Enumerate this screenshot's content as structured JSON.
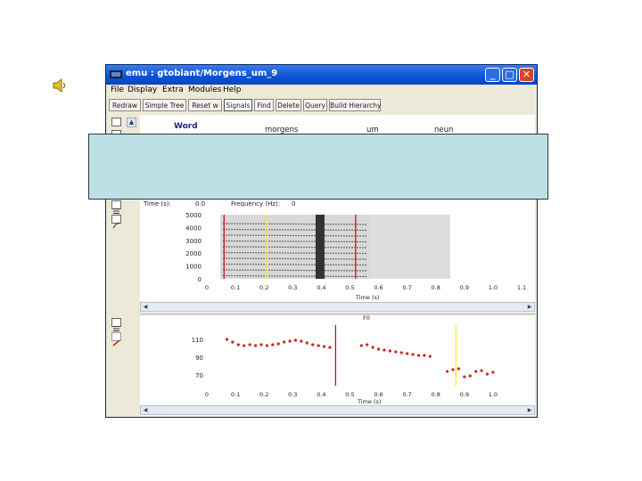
{
  "window": {
    "title": "emu : gtobiant/Morgens_um_9",
    "controls": [
      "_",
      "□",
      "✕"
    ]
  },
  "menu": [
    "File",
    "Display",
    "Extra",
    "Modules",
    "Help"
  ],
  "toolbar": {
    "buttons": [
      {
        "label": "Redraw",
        "active": false
      },
      {
        "label": "Simple Tree",
        "active": false
      },
      {
        "label": "Reset w",
        "active": false
      },
      {
        "label": "Signals",
        "active": true
      },
      {
        "label": "Find",
        "active": false
      },
      {
        "label": "Delete",
        "active": false
      },
      {
        "label": "Query",
        "active": false
      },
      {
        "label": "Build Hierarchy",
        "active": false
      }
    ]
  },
  "tiers": {
    "word_label": "Word",
    "words": [
      "morgens",
      "um",
      "neun"
    ]
  },
  "spectrogram": {
    "time_label": "Time (s):",
    "time_value": "0.0",
    "freq_label": "Frequency (Hz):",
    "freq_value": "0",
    "y_ticks": [
      "5000",
      "4000",
      "3000",
      "2000",
      "1000",
      "0"
    ],
    "x_ticks": [
      "0",
      "0.1",
      "0.2",
      "0.3",
      "0.4",
      "0.5",
      "0.6",
      "0.7",
      "0.8",
      "0.9",
      "1.0",
      "1.1"
    ],
    "x_label": "Time (s)",
    "markers": [
      {
        "t": 0.06,
        "color": "#cc0000"
      },
      {
        "t": 0.21,
        "color": "#ffee00"
      },
      {
        "t": 0.52,
        "color": "#cc0000"
      }
    ]
  },
  "f0_panel": {
    "title": "F0",
    "y_ticks": [
      "110",
      "90",
      "70"
    ],
    "x_ticks": [
      "0",
      "0.1",
      "0.2",
      "0.3",
      "0.4",
      "0.5",
      "0.6",
      "0.7",
      "0.8",
      "0.9",
      "1.0"
    ],
    "x_label": "Time (s)",
    "markers": [
      {
        "t": 0.45,
        "color": "#cc0000"
      },
      {
        "t": 0.87,
        "color": "#ffee00"
      }
    ]
  },
  "chart_data": {
    "type": "scatter",
    "title": "F0",
    "xlabel": "Time (s)",
    "ylabel": "",
    "xlim": [
      0,
      1.1
    ],
    "ylim": [
      60,
      120
    ],
    "series": [
      {
        "x": [
          0.07,
          0.09,
          0.11,
          0.13,
          0.15,
          0.17,
          0.19,
          0.21,
          0.23,
          0.25,
          0.27,
          0.29,
          0.31,
          0.33,
          0.35,
          0.37,
          0.39,
          0.41,
          0.43
        ],
        "values": [
          110,
          107,
          104,
          103,
          104,
          103,
          104,
          103,
          104,
          105,
          107,
          108,
          109,
          108,
          106,
          104,
          103,
          102,
          101
        ]
      },
      {
        "x": [
          0.54,
          0.56,
          0.58,
          0.6,
          0.62,
          0.64,
          0.66,
          0.68,
          0.7,
          0.72,
          0.74,
          0.76,
          0.78
        ],
        "values": [
          103,
          104,
          101,
          99,
          98,
          97,
          96,
          95,
          94,
          93,
          92,
          92,
          91
        ]
      },
      {
        "x": [
          0.84,
          0.86,
          0.88,
          0.9,
          0.92,
          0.94,
          0.96,
          0.98,
          1.0
        ],
        "values": [
          74,
          76,
          77,
          68,
          69,
          74,
          75,
          71,
          73
        ]
      }
    ]
  },
  "colors": {
    "titlebar": "#0a52d6",
    "f0_points": "#cc2222",
    "overlay": "#bde0e6"
  }
}
